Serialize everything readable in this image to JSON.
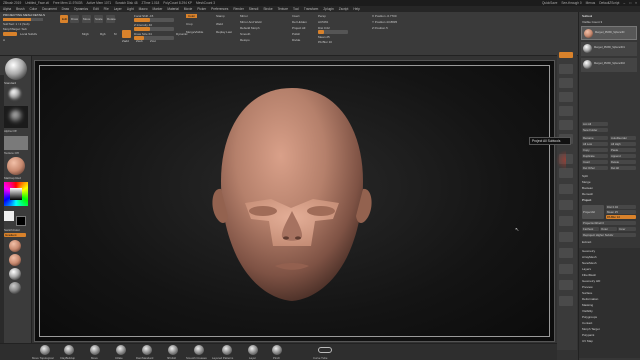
{
  "titlebar": {
    "app": "ZBrush 2019",
    "file": "Untitled_Face.ztl",
    "stats": "Free Mem 11.976GB",
    "active": "Active Mem 1071",
    "scratch": "Scratch Disk 48",
    "ztime": "ZTime 1.018",
    "poly": "PolyCount 8.294 KP",
    "mesh": "MeshCount 3",
    "quicksave": "QuickSave",
    "seethrough": "See-through 0",
    "menus": "Menus",
    "script": "DefaultZScript"
  },
  "menubar": {
    "items": [
      "Alpha",
      "Brush",
      "Color",
      "Document",
      "Draw",
      "Dynamics",
      "Edit",
      "File",
      "Layer",
      "Light",
      "Macro",
      "Marker",
      "Material",
      "Movie",
      "Picker",
      "Preferences",
      "Render",
      "Stencil",
      "Stroke",
      "Texture",
      "Tool",
      "Transform",
      "Zplugin",
      "Zscript",
      "Help"
    ]
  },
  "toptray": {
    "projecting": "PROJECTING MESH DETAILS",
    "subtool": "SubTool: 1 / 2 (Sub)",
    "morph": "MorphTarget: Sub",
    "local": "Local Subdiv",
    "buttons": [
      "Edit",
      "Draw",
      "Move",
      "Scale",
      "Rotate"
    ],
    "a_label": "A",
    "mrgb": "Mrgb",
    "rgb": "Rgb",
    "m": "M",
    "zadd": "Zadd",
    "zsub": "Zsub",
    "zcut": "Zcut",
    "focal": "Focal Shift -15",
    "intensity": "Z Intensity 40",
    "drawsize": "Draw Size 64",
    "dynamic": "Dynamic",
    "color": "Color",
    "crop": "Crop",
    "merge": "MergeVisible",
    "stamp": "Stamp",
    "weld": "Weld",
    "replay": "Replay Last",
    "mirror": "Mirror",
    "mirror_weld": "Mirror And Weld",
    "morph_morph": "Rebuild Morph",
    "smooth": "Smooth",
    "retopo": "Retopo",
    "invert": "Invert",
    "delhidden": "Del Hidden",
    "projectall": "Project All",
    "polish": "Polish",
    "divide": "Divide",
    "perspective": "Persp",
    "ac50": "AC50%",
    "dist": "Dist 0.02",
    "mean": "Mean 25",
    "pa_blur": "PA Blur 10",
    "x_pos": "X Position -6.7700",
    "y_pos": "Y Position 43.8835",
    "z_pos": "Z Position 5"
  },
  "leftshelf": {
    "brush": "Standard",
    "alpha": "Alpha Off",
    "texture": "Texture Off",
    "material": "MatCap Red",
    "switch_label": "SwitchColor",
    "gradient": "Gradient"
  },
  "rightshelf": {
    "tooltip": "Project All Subtools"
  },
  "rpanel": {
    "subtool_title": "Subtool",
    "visible_count": "Visible Count 3",
    "subtools": [
      "Merged_PM3D_Sphere3D",
      "Merged_PM3D_Sphere3D1",
      "Merged_PM3D_Sphere3D2"
    ],
    "sections": [
      "List All",
      "New Folder",
      "Rename",
      "AutoReorder",
      "All Low",
      "All High",
      "Copy",
      "Paste",
      "Duplicate",
      "Append",
      "Insert",
      "Delete",
      "Del Other",
      "Del All",
      "Split",
      "Merge",
      "Boolean",
      "Remesh",
      "Project"
    ],
    "project_title": "ProjectAll",
    "dist": "Dist 0.02",
    "mean": "Mean 25",
    "pablur": "PA Blur 10",
    "projection_shell": "ProjectionShell 0",
    "farthest": "Farthest",
    "outer": "Outer",
    "inner": "Inner",
    "reproject": "Reproject Higher Subdiv",
    "extract": "Extract",
    "lower_items": [
      "Geometry",
      "ArrayMesh",
      "NanoMesh",
      "Layers",
      "FiberMesh",
      "Geometry HD",
      "Preview",
      "Surface",
      "Deformation",
      "Masking",
      "Visibility",
      "Polygroups",
      "Contact",
      "Morph Target",
      "Polypaint",
      "UV Map"
    ]
  },
  "bottom": {
    "brushes": [
      "Move Topological",
      "ClayBuildup",
      "Move",
      "Inflate",
      "DamStandard",
      "hPolish",
      "Smooth Creases",
      "Layered Patterns",
      "Layer",
      "Pinch",
      "Curve Tube"
    ]
  },
  "colors": {
    "accent": "#d9822b",
    "skin": "#b8806a",
    "panel": "#363636"
  }
}
